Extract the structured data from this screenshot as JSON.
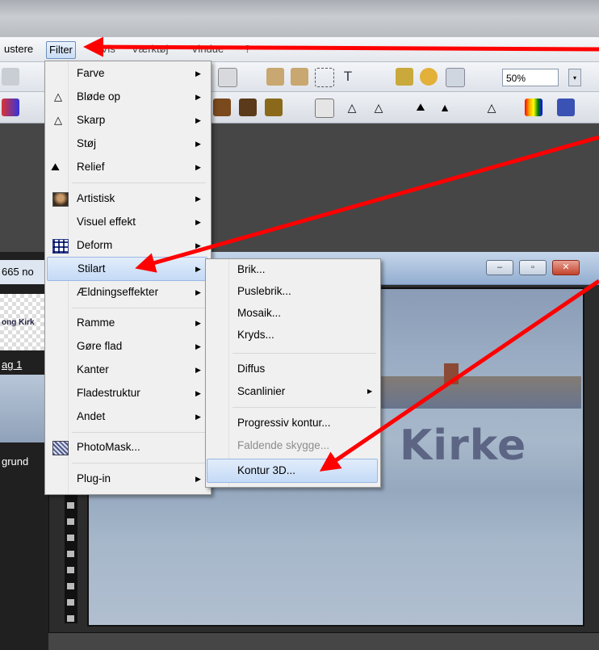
{
  "menubar": {
    "items": [
      "ustere",
      "Filter",
      "Vis",
      "Værktøj",
      "Vindue",
      "?"
    ]
  },
  "toolbar": {
    "zoom_value": "50%"
  },
  "image_window": {
    "title": "665 no"
  },
  "layers": {
    "item1": "ong Kirk",
    "item2": "ag 1",
    "item3": "grund"
  },
  "photo_text": "Kirke",
  "filter_menu": {
    "items": [
      {
        "label": "Farve",
        "submenu": true
      },
      {
        "label": "Bløde op",
        "submenu": true,
        "icon": "drop-icon"
      },
      {
        "label": "Skarp",
        "submenu": true,
        "icon": "sharpen-icon"
      },
      {
        "label": "Støj",
        "submenu": true
      },
      {
        "label": "Relief",
        "submenu": true,
        "icon": "relief-icon"
      },
      {
        "label": "Artistisk",
        "submenu": true,
        "icon": "portrait-icon"
      },
      {
        "label": "Visuel effekt",
        "submenu": true
      },
      {
        "label": "Deform",
        "submenu": true,
        "icon": "deform-icon"
      },
      {
        "label": "Stilart",
        "submenu": true,
        "highlighted": true
      },
      {
        "label": "Ældningseffekter",
        "submenu": true
      },
      {
        "label": "Ramme",
        "submenu": true
      },
      {
        "label": "Gøre flad",
        "submenu": true
      },
      {
        "label": "Kanter",
        "submenu": true
      },
      {
        "label": "Fladestruktur",
        "submenu": true
      },
      {
        "label": "Andet",
        "submenu": true
      },
      {
        "label": "PhotoMask...",
        "submenu": false,
        "icon": "photomask-icon"
      },
      {
        "label": "Plug-in",
        "submenu": true
      }
    ]
  },
  "stilart_menu": {
    "items": [
      {
        "label": "Brik..."
      },
      {
        "label": "Puslebrik..."
      },
      {
        "label": "Mosaik..."
      },
      {
        "label": "Kryds..."
      },
      {
        "label": "Diffus"
      },
      {
        "label": "Scanlinier",
        "submenu": true
      },
      {
        "label": "Progressiv kontur..."
      },
      {
        "label": "Faldende skygge...",
        "disabled": true
      },
      {
        "label": "Kontur 3D...",
        "highlighted": true
      }
    ]
  },
  "window_buttons": {
    "minimize": "–",
    "maximize": "▫",
    "close": "✕"
  },
  "colors": {
    "arrow": "#ff0000",
    "highlight": "#c4daf6"
  }
}
